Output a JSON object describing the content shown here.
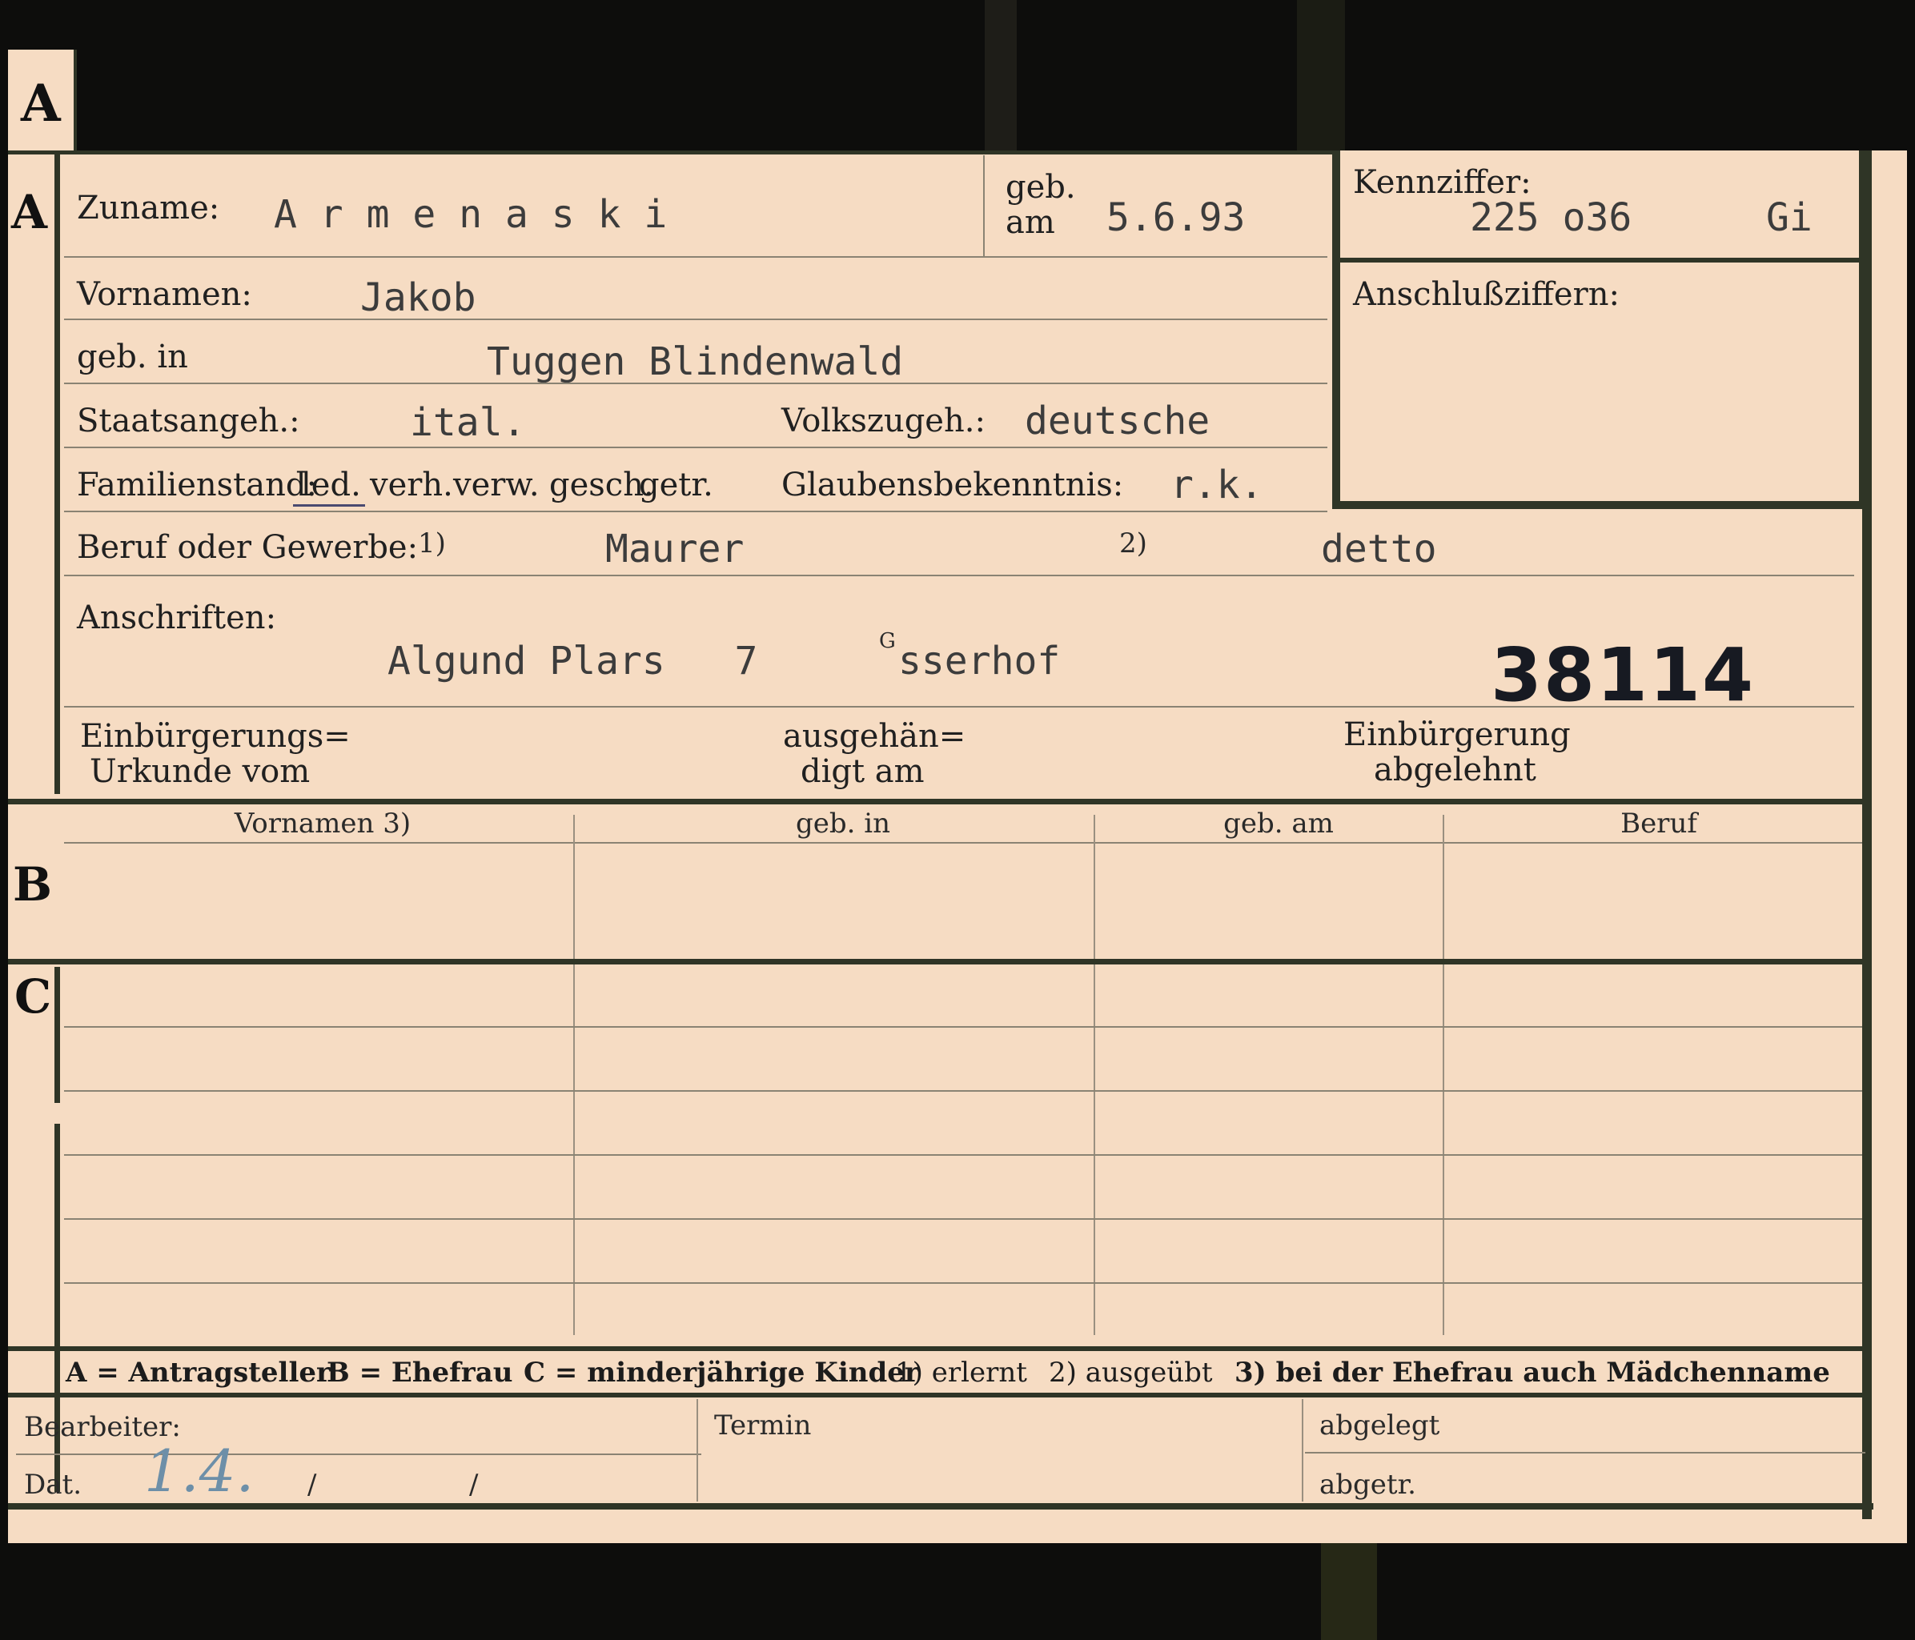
{
  "tab_letter": "A",
  "section_letters": {
    "a": "A",
    "b": "B",
    "c": "C"
  },
  "section_a": {
    "surname_label": "Zuname:",
    "surname_value": "A r m e n a s k i",
    "birth_date_label_1": "geb.",
    "birth_date_label_2": "am",
    "birth_date_value": "5.6.93",
    "first_names_label": "Vornamen:",
    "first_names_value": "Jakob",
    "birthplace_label": "geb. in",
    "birthplace_value": "Tuggen Blindenwald",
    "citizenship_label": "Staatsangeh.:",
    "citizenship_value": "ital.",
    "ethnicity_label": "Volkszugeh.:",
    "ethnicity_value": "deutsche",
    "marital_label": "Familienstand:",
    "marital_options": [
      "led.",
      "verh.",
      "verw.",
      "gesch.",
      "getr."
    ],
    "marital_selected": "led.",
    "religion_label": "Glaubensbekenntnis:",
    "religion_value": "r.k.",
    "occupation_label": "Beruf oder Gewerbe:",
    "occupation_note_1": "1)",
    "occupation_value_1": "Maurer",
    "occupation_note_2": "2)",
    "occupation_value_2": "detto",
    "addresses_label": "Anschriften:",
    "address_value": "Algund Plars   7",
    "address_extra": "sserhof",
    "address_extra_mark": "G",
    "file_number": "38114",
    "naturalization_cert_label_1": "Einbürgerungs=",
    "naturalization_cert_label_2": "Urkunde vom",
    "handed_over_label_1": "ausgehän=",
    "handed_over_label_2": "digt am",
    "naturalization_denied_label_1": "Einbürgerung",
    "naturalization_denied_label_2": "abgelehnt"
  },
  "id_box": {
    "code_label": "Kennziffer:",
    "code_value": "225 o36",
    "code_suffix": "Gi",
    "link_codes_label": "Anschlußziffern:"
  },
  "table": {
    "columns": [
      "Vornamen 3)",
      "geb. in",
      "geb. am",
      "Beruf"
    ]
  },
  "legend": {
    "items": [
      "A = Antragsteller",
      "B = Ehefrau",
      "C = minderjährige Kinder",
      "1) erlernt",
      "2) ausgeübt",
      "3) bei der Ehefrau auch Mädchenname"
    ]
  },
  "footer": {
    "clerk_label": "Bearbeiter:",
    "date_label": "Dat.",
    "date_handwritten": "1.4.",
    "date_slash_1": "/",
    "date_slash_2": "/",
    "deadline_label": "Termin",
    "filed_label": "abgelegt",
    "closed_label": "abgetr."
  },
  "colors": {
    "card": "#f6dcc3",
    "frame": "#2f3526",
    "background": "#0d0d0c",
    "stamp_ink": "#171a22",
    "handwriting": "#6d8fa8"
  }
}
